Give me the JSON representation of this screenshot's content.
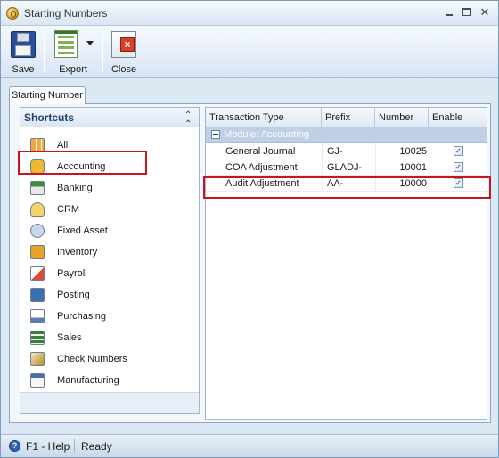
{
  "window": {
    "title": "Starting Numbers"
  },
  "toolbar": {
    "save_label": "Save",
    "export_label": "Export",
    "close_label": "Close"
  },
  "tab": {
    "label": "Starting Number"
  },
  "shortcuts": {
    "title": "Shortcuts",
    "items": [
      {
        "label": "All",
        "icon": "grid-icon"
      },
      {
        "label": "Accounting",
        "icon": "ledger-icon",
        "highlighted": true
      },
      {
        "label": "Banking",
        "icon": "bank-icon"
      },
      {
        "label": "CRM",
        "icon": "contacts-icon"
      },
      {
        "label": "Fixed Asset",
        "icon": "asset-icon"
      },
      {
        "label": "Inventory",
        "icon": "box-icon"
      },
      {
        "label": "Payroll",
        "icon": "payroll-icon"
      },
      {
        "label": "Posting",
        "icon": "posting-icon"
      },
      {
        "label": "Purchasing",
        "icon": "purchasing-icon"
      },
      {
        "label": "Sales",
        "icon": "register-icon"
      },
      {
        "label": "Check Numbers",
        "icon": "check-icon"
      },
      {
        "label": "Manufacturing",
        "icon": "calendar-icon"
      }
    ]
  },
  "grid": {
    "columns": [
      "Transaction Type",
      "Prefix",
      "Number",
      "Enable"
    ],
    "group_label": "Module: Accounting",
    "rows": [
      {
        "type": "General Journal",
        "prefix": "GJ-",
        "number": "10025",
        "enabled": true
      },
      {
        "type": "COA Adjustment",
        "prefix": "GLADJ-",
        "number": "10001",
        "enabled": true
      },
      {
        "type": "Audit Adjustment",
        "prefix": "AA-",
        "number": "10000",
        "enabled": true,
        "highlighted": true
      }
    ]
  },
  "status": {
    "help": "F1 - Help",
    "state": "Ready"
  },
  "colors": {
    "highlight": "#c8141e",
    "group_row": "#bfcfe6",
    "header_text": "#1e3f7a"
  }
}
